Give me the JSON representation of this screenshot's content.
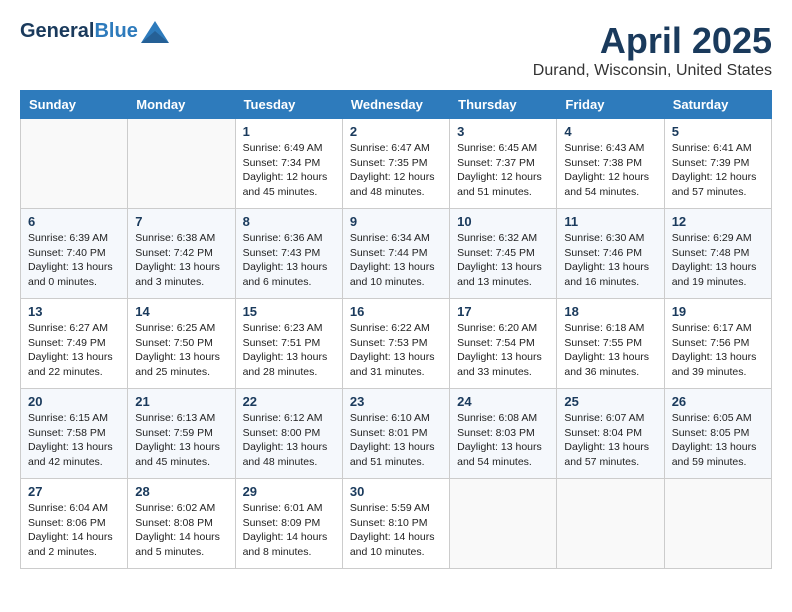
{
  "header": {
    "logo_general": "General",
    "logo_blue": "Blue",
    "title": "April 2025",
    "location": "Durand, Wisconsin, United States"
  },
  "weekdays": [
    "Sunday",
    "Monday",
    "Tuesday",
    "Wednesday",
    "Thursday",
    "Friday",
    "Saturday"
  ],
  "weeks": [
    [
      {
        "day": "",
        "content": ""
      },
      {
        "day": "",
        "content": ""
      },
      {
        "day": "1",
        "content": "Sunrise: 6:49 AM\nSunset: 7:34 PM\nDaylight: 12 hours and 45 minutes."
      },
      {
        "day": "2",
        "content": "Sunrise: 6:47 AM\nSunset: 7:35 PM\nDaylight: 12 hours and 48 minutes."
      },
      {
        "day": "3",
        "content": "Sunrise: 6:45 AM\nSunset: 7:37 PM\nDaylight: 12 hours and 51 minutes."
      },
      {
        "day": "4",
        "content": "Sunrise: 6:43 AM\nSunset: 7:38 PM\nDaylight: 12 hours and 54 minutes."
      },
      {
        "day": "5",
        "content": "Sunrise: 6:41 AM\nSunset: 7:39 PM\nDaylight: 12 hours and 57 minutes."
      }
    ],
    [
      {
        "day": "6",
        "content": "Sunrise: 6:39 AM\nSunset: 7:40 PM\nDaylight: 13 hours and 0 minutes."
      },
      {
        "day": "7",
        "content": "Sunrise: 6:38 AM\nSunset: 7:42 PM\nDaylight: 13 hours and 3 minutes."
      },
      {
        "day": "8",
        "content": "Sunrise: 6:36 AM\nSunset: 7:43 PM\nDaylight: 13 hours and 6 minutes."
      },
      {
        "day": "9",
        "content": "Sunrise: 6:34 AM\nSunset: 7:44 PM\nDaylight: 13 hours and 10 minutes."
      },
      {
        "day": "10",
        "content": "Sunrise: 6:32 AM\nSunset: 7:45 PM\nDaylight: 13 hours and 13 minutes."
      },
      {
        "day": "11",
        "content": "Sunrise: 6:30 AM\nSunset: 7:46 PM\nDaylight: 13 hours and 16 minutes."
      },
      {
        "day": "12",
        "content": "Sunrise: 6:29 AM\nSunset: 7:48 PM\nDaylight: 13 hours and 19 minutes."
      }
    ],
    [
      {
        "day": "13",
        "content": "Sunrise: 6:27 AM\nSunset: 7:49 PM\nDaylight: 13 hours and 22 minutes."
      },
      {
        "day": "14",
        "content": "Sunrise: 6:25 AM\nSunset: 7:50 PM\nDaylight: 13 hours and 25 minutes."
      },
      {
        "day": "15",
        "content": "Sunrise: 6:23 AM\nSunset: 7:51 PM\nDaylight: 13 hours and 28 minutes."
      },
      {
        "day": "16",
        "content": "Sunrise: 6:22 AM\nSunset: 7:53 PM\nDaylight: 13 hours and 31 minutes."
      },
      {
        "day": "17",
        "content": "Sunrise: 6:20 AM\nSunset: 7:54 PM\nDaylight: 13 hours and 33 minutes."
      },
      {
        "day": "18",
        "content": "Sunrise: 6:18 AM\nSunset: 7:55 PM\nDaylight: 13 hours and 36 minutes."
      },
      {
        "day": "19",
        "content": "Sunrise: 6:17 AM\nSunset: 7:56 PM\nDaylight: 13 hours and 39 minutes."
      }
    ],
    [
      {
        "day": "20",
        "content": "Sunrise: 6:15 AM\nSunset: 7:58 PM\nDaylight: 13 hours and 42 minutes."
      },
      {
        "day": "21",
        "content": "Sunrise: 6:13 AM\nSunset: 7:59 PM\nDaylight: 13 hours and 45 minutes."
      },
      {
        "day": "22",
        "content": "Sunrise: 6:12 AM\nSunset: 8:00 PM\nDaylight: 13 hours and 48 minutes."
      },
      {
        "day": "23",
        "content": "Sunrise: 6:10 AM\nSunset: 8:01 PM\nDaylight: 13 hours and 51 minutes."
      },
      {
        "day": "24",
        "content": "Sunrise: 6:08 AM\nSunset: 8:03 PM\nDaylight: 13 hours and 54 minutes."
      },
      {
        "day": "25",
        "content": "Sunrise: 6:07 AM\nSunset: 8:04 PM\nDaylight: 13 hours and 57 minutes."
      },
      {
        "day": "26",
        "content": "Sunrise: 6:05 AM\nSunset: 8:05 PM\nDaylight: 13 hours and 59 minutes."
      }
    ],
    [
      {
        "day": "27",
        "content": "Sunrise: 6:04 AM\nSunset: 8:06 PM\nDaylight: 14 hours and 2 minutes."
      },
      {
        "day": "28",
        "content": "Sunrise: 6:02 AM\nSunset: 8:08 PM\nDaylight: 14 hours and 5 minutes."
      },
      {
        "day": "29",
        "content": "Sunrise: 6:01 AM\nSunset: 8:09 PM\nDaylight: 14 hours and 8 minutes."
      },
      {
        "day": "30",
        "content": "Sunrise: 5:59 AM\nSunset: 8:10 PM\nDaylight: 14 hours and 10 minutes."
      },
      {
        "day": "",
        "content": ""
      },
      {
        "day": "",
        "content": ""
      },
      {
        "day": "",
        "content": ""
      }
    ]
  ]
}
